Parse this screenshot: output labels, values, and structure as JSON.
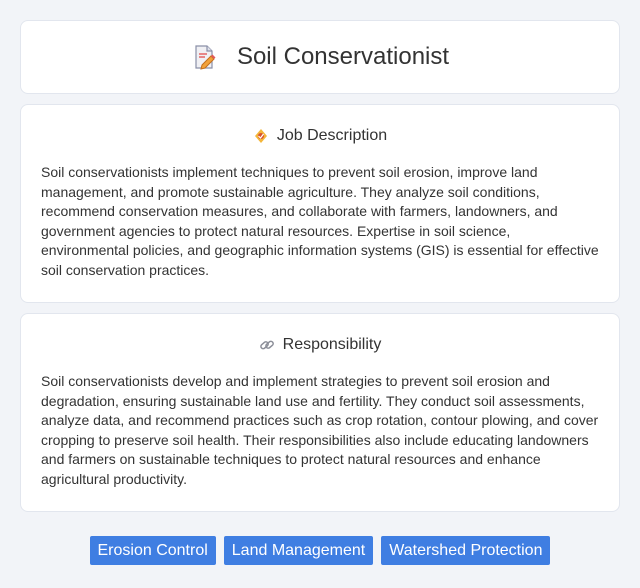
{
  "header": {
    "title": "Soil Conservationist",
    "icon": "document-pencil-icon"
  },
  "job_description": {
    "heading": "Job Description",
    "icon": "badge-icon",
    "text": "Soil conservationists implement techniques to prevent soil erosion, improve land management, and promote sustainable agriculture. They analyze soil conditions, recommend conservation measures, and collaborate with farmers, landowners, and government agencies to protect natural resources. Expertise in soil science, environmental policies, and geographic information systems (GIS) is essential for effective soil conservation practices."
  },
  "responsibility": {
    "heading": "Responsibility",
    "icon": "link-icon",
    "text": "Soil conservationists develop and implement strategies to prevent soil erosion and degradation, ensuring sustainable land use and fertility. They conduct soil assessments, analyze data, and recommend practices such as crop rotation, contour plowing, and cover cropping to preserve soil health. Their responsibilities also include educating landowners and farmers on sustainable techniques to protect natural resources and enhance agricultural productivity."
  },
  "tags": [
    "Erosion Control",
    "Land Management",
    "Watershed Protection"
  ],
  "colors": {
    "tag_background": "#3f7ee2",
    "page_background": "#f2f4f8"
  }
}
